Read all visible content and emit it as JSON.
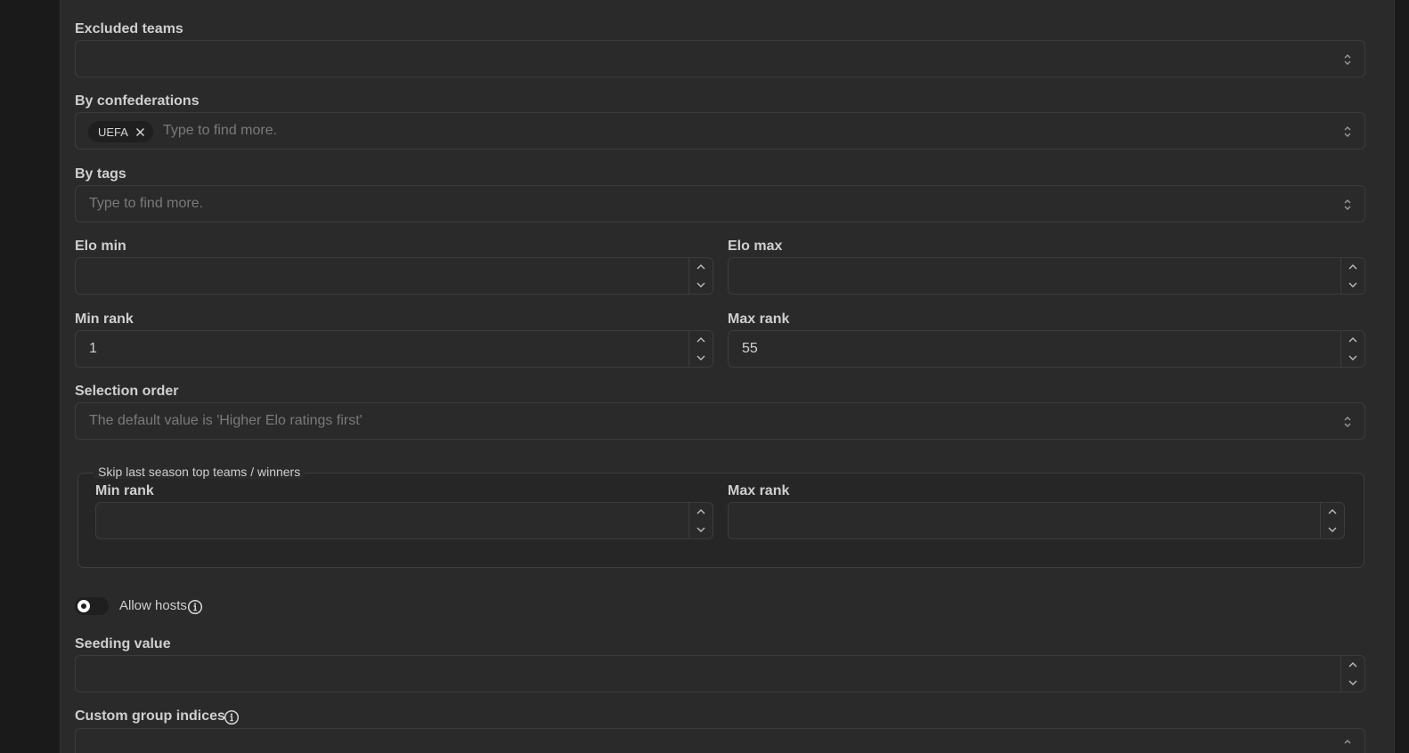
{
  "excluded_teams": {
    "label": "Excluded teams"
  },
  "by_confederations": {
    "label": "By confederations",
    "chips": [
      "UEFA"
    ],
    "placeholder": "Type to find more."
  },
  "by_tags": {
    "label": "By tags",
    "placeholder": "Type to find more."
  },
  "elo_min": {
    "label": "Elo min",
    "value": ""
  },
  "elo_max": {
    "label": "Elo max",
    "value": ""
  },
  "min_rank": {
    "label": "Min rank",
    "value": "1"
  },
  "max_rank": {
    "label": "Max rank",
    "value": "55"
  },
  "selection_order": {
    "label": "Selection order",
    "placeholder": "The default value is 'Higher Elo ratings first'"
  },
  "skip_last_season": {
    "legend": "Skip last season top teams / winners",
    "min_rank": {
      "label": "Min rank",
      "value": ""
    },
    "max_rank": {
      "label": "Max rank",
      "value": ""
    }
  },
  "allow_hosts": {
    "label": "Allow hosts",
    "enabled": false
  },
  "seeding_value": {
    "label": "Seeding value",
    "value": ""
  },
  "custom_group_indices": {
    "label": "Custom group indices"
  },
  "colors": {
    "background": "#1a1a1a",
    "panel": "#2a2a2a",
    "border": "#3c3c3c",
    "text": "#cfcfcf",
    "placeholder": "#7a7a7a"
  }
}
